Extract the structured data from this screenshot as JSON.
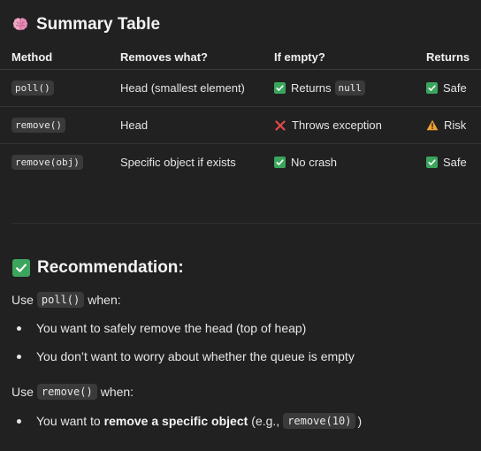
{
  "summary": {
    "title": "Summary Table",
    "icon": "brain-icon",
    "headers": [
      "Method",
      "Removes what?",
      "If empty?",
      "Returns"
    ],
    "rows": [
      {
        "method": "poll()",
        "removes": "Head (smallest element)",
        "if_empty_icon": "check-icon",
        "if_empty_text": "Returns",
        "if_empty_code": "null",
        "returns_icon": "check-icon",
        "returns_text": "Safe"
      },
      {
        "method": "remove()",
        "removes": "Head",
        "if_empty_icon": "cross-icon",
        "if_empty_text": "Throws exception",
        "returns_icon": "warning-icon",
        "returns_text": "Risk"
      },
      {
        "method": "remove(obj)",
        "removes": "Specific object if exists",
        "if_empty_icon": "check-icon",
        "if_empty_text": "No crash",
        "returns_icon": "check-icon",
        "returns_text": "Safe"
      }
    ]
  },
  "recommendation": {
    "title": "Recommendation:",
    "icon": "check-icon",
    "poll_intro": {
      "prefix": "Use",
      "code": "poll()",
      "suffix": "when:"
    },
    "poll_bullets": [
      "You want to safely remove the head (top of heap)",
      "You don’t want to worry about whether the queue is empty"
    ],
    "remove_intro": {
      "prefix": "Use",
      "code": "remove()",
      "suffix": "when:"
    },
    "remove_bullet": {
      "prefix": "You want to",
      "bold": "remove a specific object",
      "middle": "(e.g.,",
      "code": "remove(10)",
      "suffix": ")"
    }
  },
  "colors": {
    "background": "#212121",
    "text": "#ececec",
    "check_green": "#3ba55d",
    "cross_red": "#e5484d",
    "warning_orange": "#f0a22e",
    "code_bg": "#3a3a3a"
  }
}
